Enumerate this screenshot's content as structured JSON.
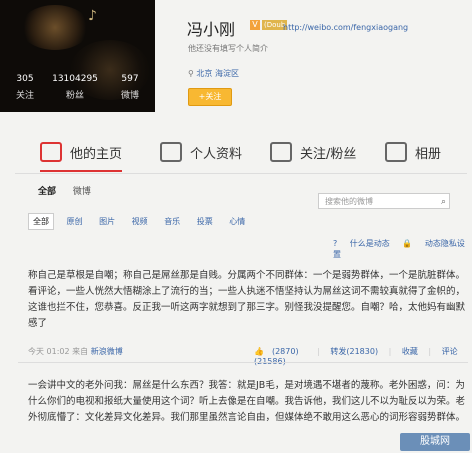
{
  "profile": {
    "name": "冯小刚",
    "v_badge": "V",
    "v_tag": "(Doub",
    "url": "http://weibo.com/fengxiaogang",
    "bio": "他还没有填写个人简介",
    "location_prefix": "北京",
    "location_district": "海淀区",
    "follow_label": "关注",
    "stats": [
      {
        "num": "305",
        "label": "关注"
      },
      {
        "num": "13104295",
        "label": "粉丝"
      },
      {
        "num": "597",
        "label": "微博"
      }
    ]
  },
  "tabs": [
    {
      "label": "他的主页",
      "icon": "home-icon"
    },
    {
      "label": "个人资料",
      "icon": "person-icon"
    },
    {
      "label": "关注/粉丝",
      "icon": "people-icon"
    },
    {
      "label": "相册",
      "icon": "camera-icon"
    }
  ],
  "subnav": {
    "all": "全部",
    "weibo": "微博"
  },
  "search_placeholder": "搜索他的微博",
  "filters": [
    "全部",
    "原创",
    "图片",
    "视频",
    "音乐",
    "投票",
    "心情"
  ],
  "help_links": [
    "什么是动态",
    "动态隐私设置"
  ],
  "post1": {
    "text": "称自己是草根是自嘲；称自己是屌丝那是自贱。分属两个不同群体：一个是弱势群体，一个是肮脏群体。看评论，一些人恍然大悟糊涂上了流行的当；一些人执迷不悟坚持认为屌丝这词不需较真就得了金帜的，这谁也拦不住，您恭喜。反正我一听这两字就想到了那三字。别怪我没提醒您。自嘲？哈，太他妈有幽默感了",
    "time": "今天 01:02",
    "source_prefix": "来自",
    "source": "新浪微博",
    "likes": "(2870)",
    "repost": "转发(21830)",
    "fav": "收藏",
    "comment": "评论(21586)"
  },
  "post2": {
    "text": "一会讲中文的老外问我：屌丝是什么东西？我答：就是JB毛，是对境遇不堪者的蔑称。老外困惑，问：为什么你们的电视和报纸大量使用这个词？听上去像是在自嘲。我告诉他，我们这儿不以为耻反以为荣。老外彻底懵了：文化差异文化差异。我们那里虽然言论自由，但媒体绝不敢用这么恶心的词形容弱势群体。"
  },
  "watermark": "股城网"
}
